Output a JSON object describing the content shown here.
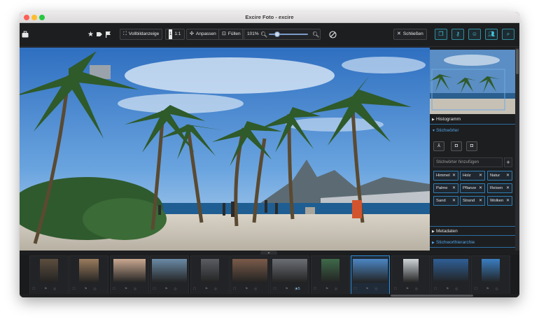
{
  "window": {
    "title": "Excire Foto - excire"
  },
  "toolbar": {
    "fullscreen_label": "Vollbildanzeige",
    "one_to_one_label": "1:1",
    "fit_label": "Anpassen",
    "fill_label": "Füllen",
    "zoom_value": "101%",
    "zoom_fraction": 0.22,
    "close_label": "Schließen"
  },
  "panel": {
    "histogram_label": "Histogramm",
    "keywords_label": "Stichwörter",
    "keyword_input_placeholder": "Stichwörter hinzufügen",
    "keywords": [
      "Himmel",
      "Holz",
      "Natur",
      "Palme",
      "Pflanze",
      "Reisen",
      "Sand",
      "Strand",
      "Wolken"
    ],
    "metadata_label": "Metadaten",
    "hierarchy_label": "Stichworthierarchie"
  },
  "filmstrip": {
    "selected_index": 8,
    "star_index": 6,
    "star_count": "5",
    "thumbnails": [
      {
        "name": "portrait-mural",
        "bg": "#5c4e3e"
      },
      {
        "name": "cat-tabby",
        "bg": "#9a7b5d"
      },
      {
        "name": "cat-fluffy",
        "bg": "#c9a890"
      },
      {
        "name": "landscape-road",
        "bg": "#6a8aa6"
      },
      {
        "name": "couple-selfie",
        "bg": "#5b5d63"
      },
      {
        "name": "group-selfie",
        "bg": "#7a5b4a"
      },
      {
        "name": "two-men",
        "bg": "#6b6e74"
      },
      {
        "name": "plant",
        "bg": "#3f6a4a"
      },
      {
        "name": "beach-palms",
        "bg": "#4c86c4"
      },
      {
        "name": "man-portrait",
        "bg": "#cfd4d8"
      },
      {
        "name": "architecture",
        "bg": "#2f5f96"
      },
      {
        "name": "beach-small",
        "bg": "#3a7ec2"
      }
    ]
  }
}
